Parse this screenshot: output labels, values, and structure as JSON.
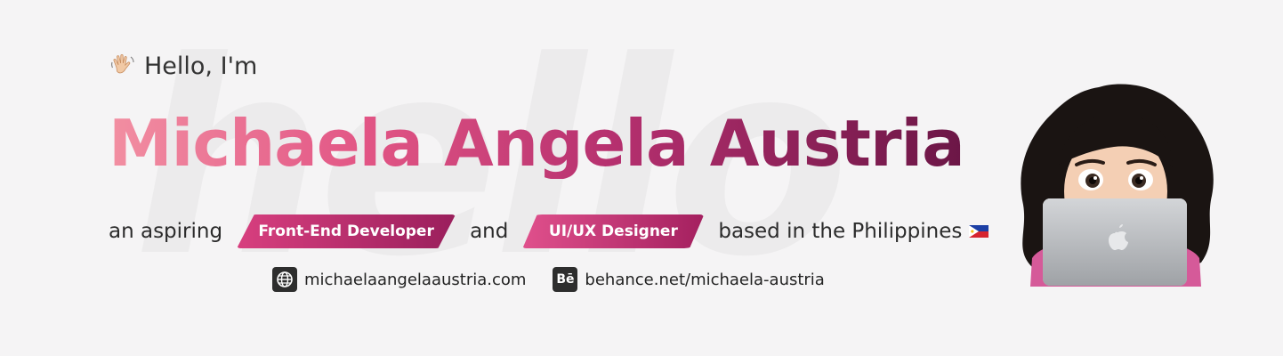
{
  "watermark": "hello",
  "greeting": {
    "text": "Hello, I'm",
    "icon": "waving-hand-icon"
  },
  "name": "Michaela Angela Austria",
  "tagline": {
    "prefix": "an aspiring",
    "role_1": "Front-End Developer",
    "joiner": "and",
    "role_2": "UI/UX Designer",
    "suffix": "based in the Philippines",
    "flag_icon": "philippines-flag-icon"
  },
  "links": {
    "website": {
      "icon": "globe-icon",
      "label": "michaelaangelaaustria.com"
    },
    "behance": {
      "icon": "behance-icon",
      "icon_text": "Bē",
      "label": "behance.net/michaela-austria"
    }
  },
  "colors": {
    "gradient_start": "#f28fa2",
    "gradient_end": "#6b1646",
    "background": "#f5f4f5"
  }
}
